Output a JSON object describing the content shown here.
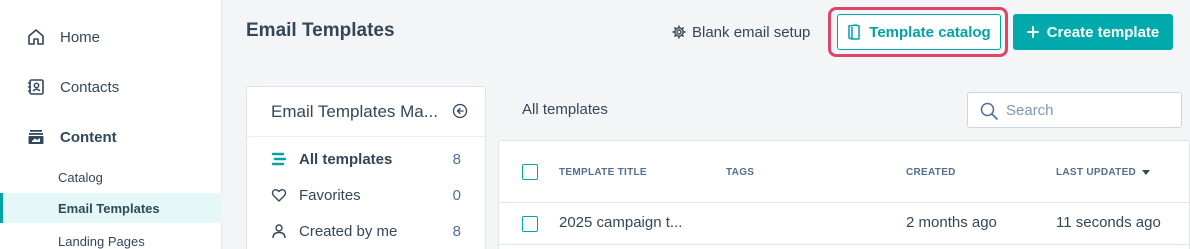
{
  "sidebar": {
    "nav": [
      {
        "label": "Home",
        "icon": "home-icon"
      },
      {
        "label": "Contacts",
        "icon": "contacts-icon"
      },
      {
        "label": "Content",
        "icon": "content-icon"
      }
    ],
    "sub": [
      {
        "label": "Catalog"
      },
      {
        "label": "Email Templates",
        "active": true
      },
      {
        "label": "Landing Pages"
      }
    ]
  },
  "header": {
    "title": "Email Templates",
    "blank_setup_label": "Blank email setup",
    "catalog_label": "Template catalog",
    "create_label": "Create template"
  },
  "folders": {
    "title": "Email Templates Ma...",
    "items": [
      {
        "label": "All templates",
        "count": "8",
        "icon": "all-templates-icon"
      },
      {
        "label": "Favorites",
        "count": "0",
        "icon": "heart-icon"
      },
      {
        "label": "Created by me",
        "count": "8",
        "icon": "person-icon"
      }
    ]
  },
  "main": {
    "section_label": "All templates",
    "search": {
      "placeholder": "Search",
      "value": ""
    },
    "columns": [
      "TEMPLATE TITLE",
      "TAGS",
      "CREATED",
      "LAST UPDATED"
    ],
    "rows": [
      {
        "title": "2025 campaign t...",
        "tags": "",
        "created": "2 months ago",
        "updated": "11 seconds ago"
      }
    ]
  },
  "colors": {
    "accent": "#00a4a6",
    "highlight": "#d9486a",
    "text": "#33475b"
  }
}
